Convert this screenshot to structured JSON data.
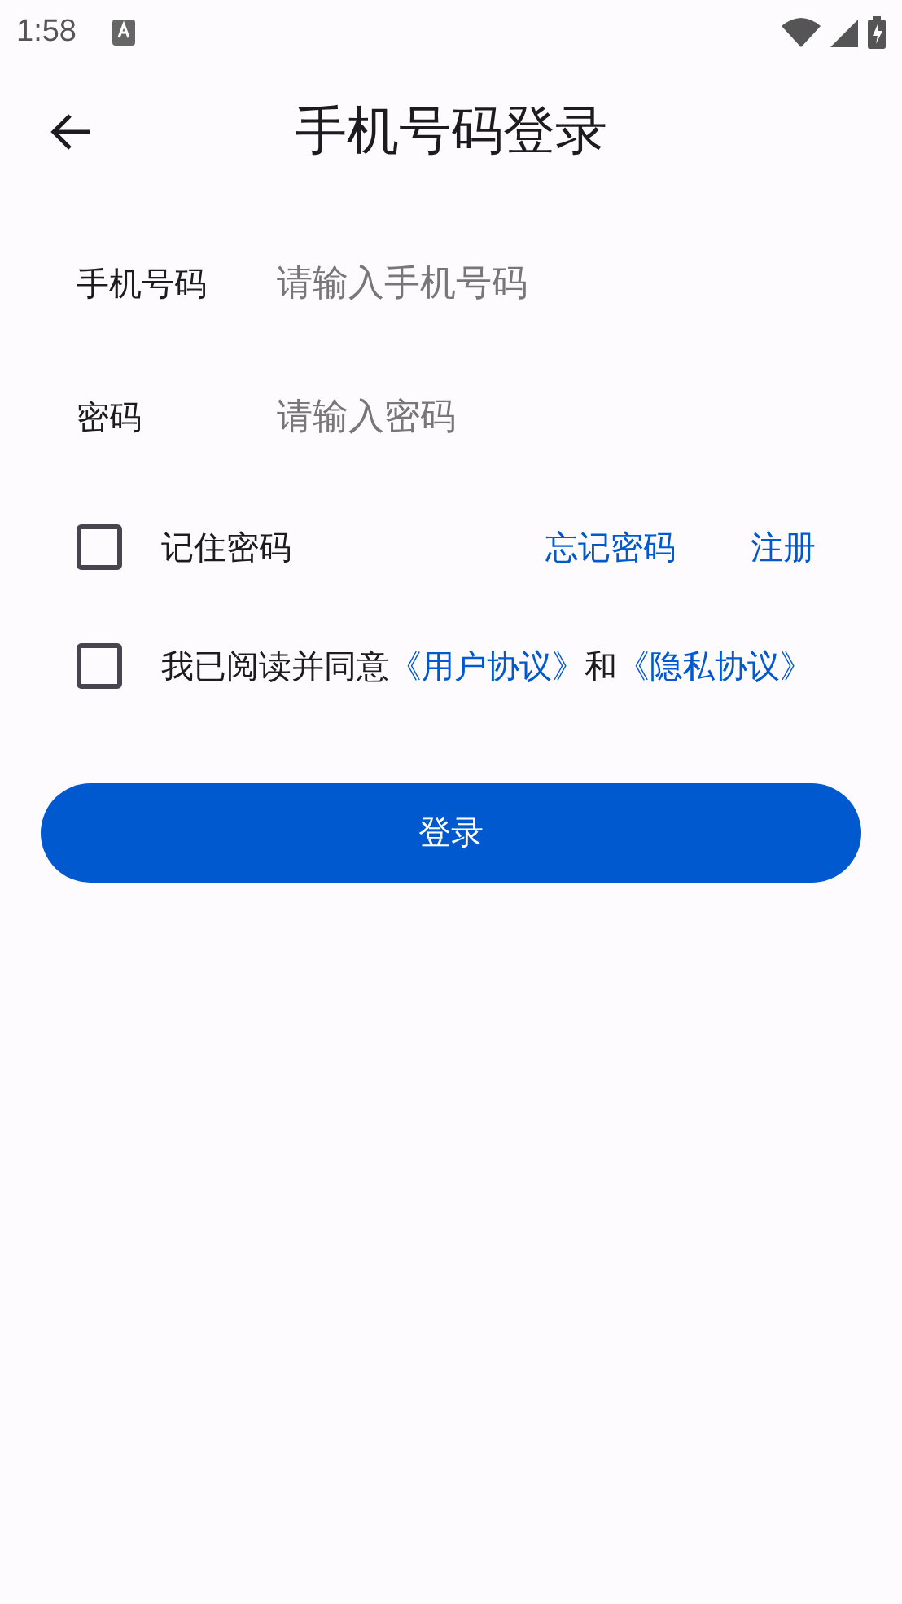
{
  "status_bar": {
    "time": "1:58"
  },
  "app_bar": {
    "title": "手机号码登录"
  },
  "fields": [
    {
      "label": "手机号码",
      "placeholder": "请输入手机号码"
    },
    {
      "label": "密码",
      "placeholder": "请输入密码"
    }
  ],
  "remember": {
    "label": "记住密码",
    "checked": false,
    "links": [
      "忘记密码",
      "注册"
    ]
  },
  "agreement": {
    "checked": false,
    "parts": [
      {
        "kind": "text",
        "text": "我已阅读并同意"
      },
      {
        "kind": "link",
        "text": "《用户协议》"
      },
      {
        "kind": "text",
        "text": "和"
      },
      {
        "kind": "link",
        "text": "《隐私协议》"
      }
    ]
  },
  "login_button": {
    "label": "登录"
  }
}
